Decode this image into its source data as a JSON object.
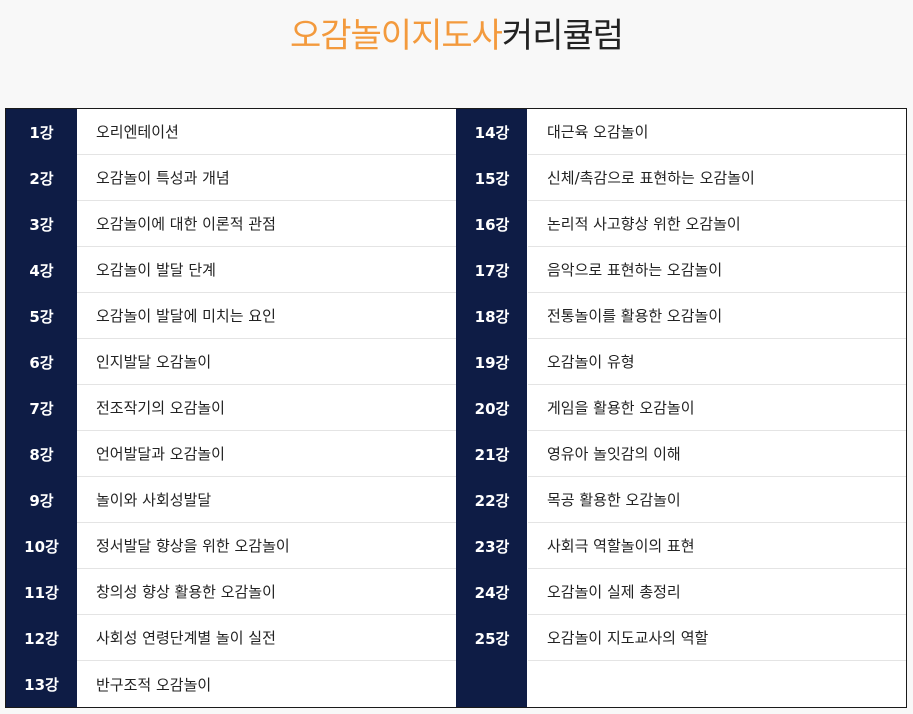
{
  "title": {
    "accent": "오감놀이지도사",
    "rest": "커리큘럼"
  },
  "left_rows": [
    {
      "num": "1강",
      "text": "오리엔테이션"
    },
    {
      "num": "2강",
      "text": "오감놀이 특성과 개념"
    },
    {
      "num": "3강",
      "text": "오감놀이에 대한 이론적 관점"
    },
    {
      "num": "4강",
      "text": "오감놀이 발달 단계"
    },
    {
      "num": "5강",
      "text": "오감놀이 발달에 미치는 요인"
    },
    {
      "num": "6강",
      "text": "인지발달 오감놀이"
    },
    {
      "num": "7강",
      "text": "전조작기의 오감놀이"
    },
    {
      "num": "8강",
      "text": "언어발달과 오감놀이"
    },
    {
      "num": "9강",
      "text": "놀이와 사회성발달"
    },
    {
      "num": "10강",
      "text": "정서발달 향상을 위한 오감놀이"
    },
    {
      "num": "11강",
      "text": "창의성 향상 활용한 오감놀이"
    },
    {
      "num": "12강",
      "text": "사회성 연령단계별 놀이 실전"
    },
    {
      "num": "13강",
      "text": "반구조적 오감놀이"
    }
  ],
  "right_rows": [
    {
      "num": "14강",
      "text": "대근육 오감놀이"
    },
    {
      "num": "15강",
      "text": "신체/촉감으로 표현하는 오감놀이"
    },
    {
      "num": "16강",
      "text": "논리적 사고향상 위한 오감놀이"
    },
    {
      "num": "17강",
      "text": "음악으로 표현하는 오감놀이"
    },
    {
      "num": "18강",
      "text": "전통놀이를 활용한 오감놀이"
    },
    {
      "num": "19강",
      "text": "오감놀이 유형"
    },
    {
      "num": "20강",
      "text": "게임을 활용한 오감놀이"
    },
    {
      "num": "21강",
      "text": "영유아 놀잇감의 이해"
    },
    {
      "num": "22강",
      "text": "목공 활용한 오감놀이"
    },
    {
      "num": "23강",
      "text": "사회극 역할놀이의 표현"
    },
    {
      "num": "24강",
      "text": "오감놀이 실제 총정리"
    },
    {
      "num": "25강",
      "text": "오감놀이 지도교사의 역할"
    }
  ],
  "colors": {
    "accent": "#f39a3d",
    "navy": "#0e1c45"
  }
}
